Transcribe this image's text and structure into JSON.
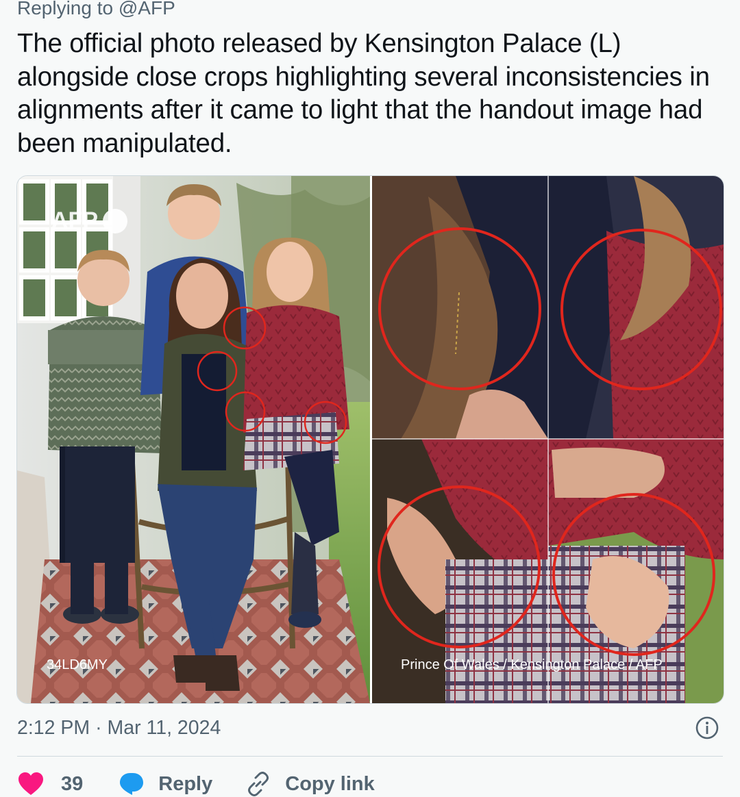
{
  "reply_context": {
    "prefix": "Replying to",
    "handle": "@AFP"
  },
  "tweet": {
    "text": "The official photo released by Kensington Palace (L) alongside close crops highlighting several inconsistencies in alignments after it came to light that the handout image had been manipulated."
  },
  "media": {
    "watermark": "AFP",
    "photo_id": "34LD6MY",
    "credit": "Prince Of Wales / Kensington Palace / AFP"
  },
  "meta": {
    "time": "2:12 PM",
    "separator": "·",
    "date": "Mar 11, 2024"
  },
  "actions": {
    "like_count": "39",
    "reply_label": "Reply",
    "copy_label": "Copy link"
  },
  "colors": {
    "like": "#f91880",
    "reply": "#1d9bf0",
    "muted": "#536471",
    "text": "#0f1419",
    "highlight_circle": "#e0261d"
  },
  "icons": {
    "like": "heart-icon",
    "reply": "chat-bubble-icon",
    "copy": "link-icon",
    "info": "info-icon"
  }
}
